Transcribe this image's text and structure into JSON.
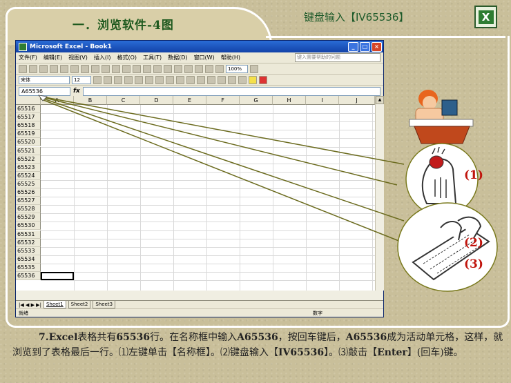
{
  "slide": {
    "title": "一．浏览软件-4图",
    "top_hint": "键盘输入【IV65536】",
    "logo_letter": "X"
  },
  "excel": {
    "window_title": "Microsoft Excel - Book1",
    "window_buttons": [
      "_",
      "□",
      "×"
    ],
    "menus": [
      "文件(F)",
      "编辑(E)",
      "视图(V)",
      "插入(I)",
      "格式(O)",
      "工具(T)",
      "数据(D)",
      "窗口(W)",
      "帮助(H)"
    ],
    "help_placeholder": "键入需要帮助的问题",
    "zoom": "100%",
    "font_name": "宋体",
    "font_size": "12",
    "name_box": "A65536",
    "fx_label": "fx",
    "columns": [
      "A",
      "B",
      "C",
      "D",
      "E",
      "F",
      "G",
      "H",
      "I",
      "J"
    ],
    "rows": [
      "65516",
      "65517",
      "65518",
      "65519",
      "65520",
      "65521",
      "65522",
      "65523",
      "65524",
      "65525",
      "65526",
      "65527",
      "65528",
      "65529",
      "65530",
      "65531",
      "65532",
      "65533",
      "65534",
      "65535",
      "65536"
    ],
    "sheet_tabs": [
      "Sheet1",
      "Sheet2",
      "Sheet3"
    ],
    "nav_arrows": "|◀ ◀ ▶ ▶|",
    "status_left": "就绪",
    "status_right": "数字"
  },
  "steps": [
    "(1)",
    "(2)",
    "(3)"
  ],
  "caption": {
    "p1": "7.",
    "p2": "Excel",
    "p3": "表格共有",
    "p4": "65536",
    "p5": "行。在名称框中输入",
    "p6": "A65536",
    "p7": "，按回车键后，",
    "p8": "A65536",
    "p9": "成为活动单元格，这样，就浏览到了表格最后一行。⑴左键单击【名称框】。⑵键盘输入【",
    "p10": "IV65536",
    "p11": "】。⑶敲击【",
    "p12": "Enter",
    "p13": "】(回车)键。"
  }
}
